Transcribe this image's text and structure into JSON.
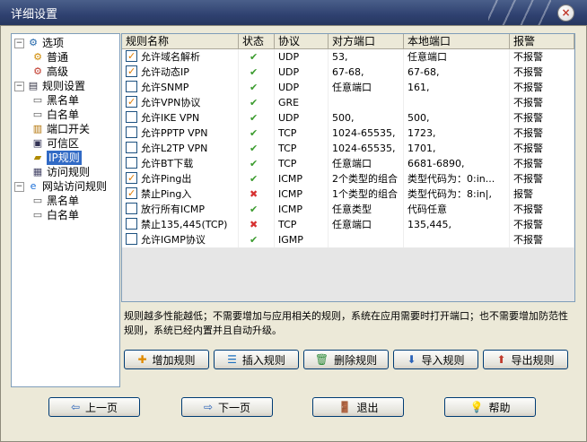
{
  "window": {
    "title": "详细设置",
    "close": "×"
  },
  "tree": [
    {
      "label": "选项",
      "icon": "gear-icon"
    },
    {
      "label": "普通",
      "icon": "gear-icon"
    },
    {
      "label": "高级",
      "icon": "gear-icon"
    },
    {
      "label": "规则设置",
      "icon": "rules-icon"
    },
    {
      "label": "黑名单",
      "icon": "document-icon"
    },
    {
      "label": "白名单",
      "icon": "document-icon"
    },
    {
      "label": "端口开关",
      "icon": "port-icon"
    },
    {
      "label": "可信区",
      "icon": "computer-icon"
    },
    {
      "label": "IP规则",
      "icon": "folder-icon"
    },
    {
      "label": "访问规则",
      "icon": "exe-icon"
    },
    {
      "label": "网站访问规则",
      "icon": "ie-icon"
    },
    {
      "label": "黑名单",
      "icon": "document-icon"
    },
    {
      "label": "白名单",
      "icon": "document-icon"
    }
  ],
  "table": {
    "headers": [
      "规则名称",
      "状态",
      "协议",
      "对方端口",
      "本地端口",
      "报警"
    ],
    "rows": [
      {
        "checked": true,
        "name": "允许域名解析",
        "status": "ok",
        "proto": "UDP",
        "remote": "53,",
        "local": "任意端口",
        "alarm": "不报警"
      },
      {
        "checked": true,
        "name": "允许动态IP",
        "status": "ok",
        "proto": "UDP",
        "remote": "67-68,",
        "local": "67-68,",
        "alarm": "不报警"
      },
      {
        "checked": false,
        "name": "允许SNMP",
        "status": "ok",
        "proto": "UDP",
        "remote": "任意端口",
        "local": "161,",
        "alarm": "不报警"
      },
      {
        "checked": true,
        "name": "允许VPN协议",
        "status": "ok",
        "proto": "GRE",
        "remote": "",
        "local": "",
        "alarm": "不报警"
      },
      {
        "checked": false,
        "name": "允许IKE VPN",
        "status": "ok",
        "proto": "UDP",
        "remote": "500,",
        "local": "500,",
        "alarm": "不报警"
      },
      {
        "checked": false,
        "name": "允许PPTP VPN",
        "status": "ok",
        "proto": "TCP",
        "remote": "1024-65535,",
        "local": "1723,",
        "alarm": "不报警"
      },
      {
        "checked": false,
        "name": "允许L2TP VPN",
        "status": "ok",
        "proto": "TCP",
        "remote": "1024-65535,",
        "local": "1701,",
        "alarm": "不报警"
      },
      {
        "checked": false,
        "name": "允许BT下载",
        "status": "ok",
        "proto": "TCP",
        "remote": "任意端口",
        "local": "6681-6890,",
        "alarm": "不报警"
      },
      {
        "checked": true,
        "name": "允许Ping出",
        "status": "ok",
        "proto": "ICMP",
        "remote": "2个类型的组合",
        "local": "类型代码为：0:in...",
        "alarm": "不报警"
      },
      {
        "checked": true,
        "name": "禁止Ping入",
        "status": "no",
        "proto": "ICMP",
        "remote": "1个类型的组合",
        "local": "类型代码为：8:in|,",
        "alarm": "报警"
      },
      {
        "checked": false,
        "name": "放行所有ICMP",
        "status": "ok",
        "proto": "ICMP",
        "remote": "任意类型",
        "local": "代码任意",
        "alarm": "不报警"
      },
      {
        "checked": false,
        "name": "禁止135,445(TCP)",
        "status": "no",
        "proto": "TCP",
        "remote": "任意端口",
        "local": "135,445,",
        "alarm": "不报警"
      },
      {
        "checked": false,
        "name": "允许IGMP协议",
        "status": "ok",
        "proto": "IGMP",
        "remote": "",
        "local": "",
        "alarm": "不报警"
      }
    ]
  },
  "description": "规则越多性能越低；不需要增加与应用相关的规则，系统在应用需要时打开端口；也不需要增加防范性规则，系统已经内置并且自动升级。",
  "rule_buttons": [
    {
      "label": "增加规则",
      "icon": "plus-icon",
      "glyph": "✚",
      "color": "#e08a00"
    },
    {
      "label": "插入规则",
      "icon": "insert-icon",
      "glyph": "☰",
      "color": "#1c6fbf"
    },
    {
      "label": "删除规则",
      "icon": "trash-icon",
      "glyph": "🗑",
      "color": "#2e8b3a"
    },
    {
      "label": "导入规则",
      "icon": "import-icon",
      "glyph": "⬇",
      "color": "#2a62b8"
    },
    {
      "label": "导出规则",
      "icon": "export-icon",
      "glyph": "⬆",
      "color": "#c0392b"
    }
  ],
  "nav_buttons": [
    {
      "label": "上一页",
      "icon": "arrow-left-icon",
      "glyph": "⇦",
      "color": "#2a62b8"
    },
    {
      "label": "下一页",
      "icon": "arrow-right-icon",
      "glyph": "⇨",
      "color": "#2a62b8"
    },
    {
      "label": "退出",
      "icon": "exit-door-icon",
      "glyph": "🚪",
      "color": "#8a5a2b"
    },
    {
      "label": "帮助",
      "icon": "lightbulb-icon",
      "glyph": "💡",
      "color": "#d8a000"
    }
  ]
}
